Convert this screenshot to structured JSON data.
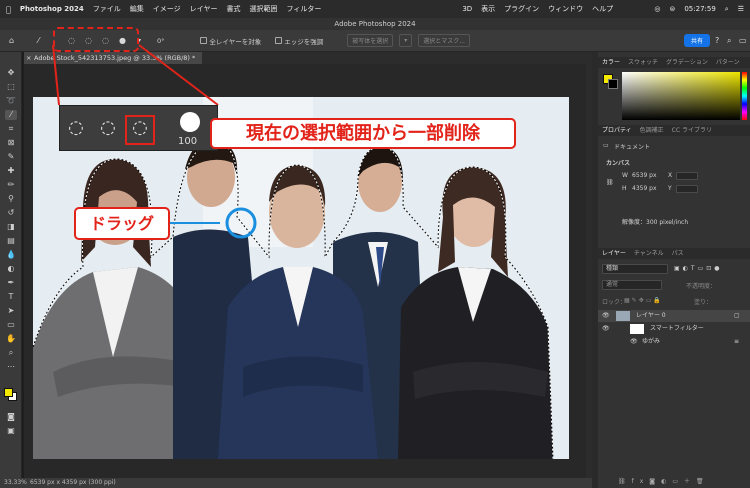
{
  "menubar": {
    "app": "Photoshop 2024",
    "items": [
      "ファイル",
      "編集",
      "イメージ",
      "レイヤー",
      "書式",
      "選択範囲",
      "フィルター",
      "3D",
      "表示",
      "プラグイン",
      "ウィンドウ",
      "ヘルプ"
    ],
    "clock": "05:27:59"
  },
  "window": {
    "title": "Adobe Photoshop 2024"
  },
  "options": {
    "brush_size": "0°",
    "chk_all_layers": "全レイヤーを対象",
    "chk_edge": "エッジを強調",
    "btn_subject": "被写体を選択",
    "btn_select_mask": "選択とマスク...",
    "share": "共有"
  },
  "document": {
    "tab": "Adobe Stock_542313753.jpeg @ 33.3% (RGB/8) *"
  },
  "status": {
    "zoom": "33.33%",
    "info": "6539 px x 4359 px (300 ppi)"
  },
  "panels": {
    "color_tabs": [
      "カラー",
      "スウォッチ",
      "グラデーション",
      "パターン"
    ],
    "props_tabs": [
      "プロパティ",
      "色調補正",
      "CC ライブラリ"
    ],
    "doc_label": "ドキュメント",
    "canvas_label": "カンバス",
    "w_label": "W",
    "w_value": "6539 px",
    "x_label": "X",
    "h_label": "H",
    "h_value": "4359 px",
    "y_label": "Y",
    "resolution": "解像度：300 pixel/inch",
    "layer_tabs": [
      "レイヤー",
      "チャンネル",
      "パス"
    ],
    "filter_kind": "種類",
    "blend": "通常",
    "opacity_label": "不透明度：",
    "lock_label": "ロック：",
    "fill_label": "塗り：",
    "layers": [
      {
        "name": "レイヤー 0"
      },
      {
        "name": "スマートフィルター"
      },
      {
        "name": "ゆがみ"
      }
    ]
  },
  "overlay": {
    "zoom_size": "100",
    "callout_main": "現在の選択範囲から一部削除",
    "callout_drag": "ドラッグ"
  },
  "colors": {
    "accent": "#e2231a",
    "share": "#1473e6",
    "fg_swatch": "#f5e900"
  }
}
